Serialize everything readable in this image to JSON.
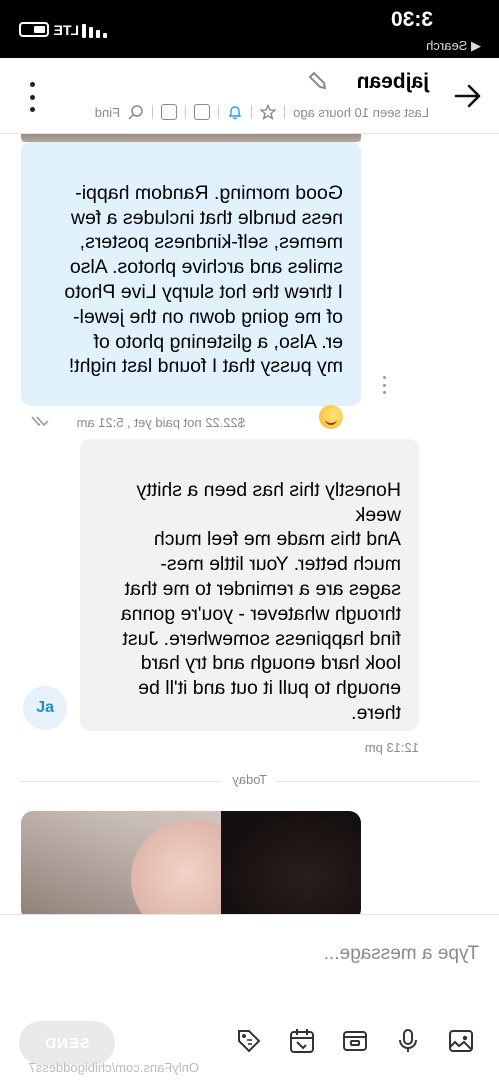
{
  "status_bar": {
    "time": "3:30",
    "back_label": "◀ Search",
    "network": "LTE"
  },
  "header": {
    "title": "jajbean",
    "last_seen": "Last seen 10 hours ago",
    "find_label": "Find"
  },
  "messages": [
    {
      "text": "Good morning. Random happi-\nness bundle that includes a few\nmemes, self-kindness posters,\nsmiles and archive photos. Also\nI threw the hot slurpy Live Photo\nof me going down on the jewel-\ner. Also, a glistening photo of\nmy pussy that I found last night!",
      "meta": "$22.22 not paid yet , 5:21 am"
    },
    {
      "text": "Honestly this has been a shitty\nweek\nAnd this made me feel much\nmuch better. Your little mes-\nsages are a reminder to me that\nthrough whatever - you're gonna\nfind happiness somewhere. Just\nlook hard enough and try hard\nenough to pull it out and it'll be\nthere.",
      "meta": "12:13 pm",
      "avatar": "Ja"
    }
  ],
  "divider": "Today",
  "composer": {
    "placeholder": "Type a message...",
    "send_label": "SEND"
  },
  "watermark": "OnlyFans.com/chibigoddess7",
  "colors": {
    "outgoing_bubble": "#e1f2fc",
    "incoming_bubble": "#f2f2f4",
    "accent": "#1da1f2"
  }
}
